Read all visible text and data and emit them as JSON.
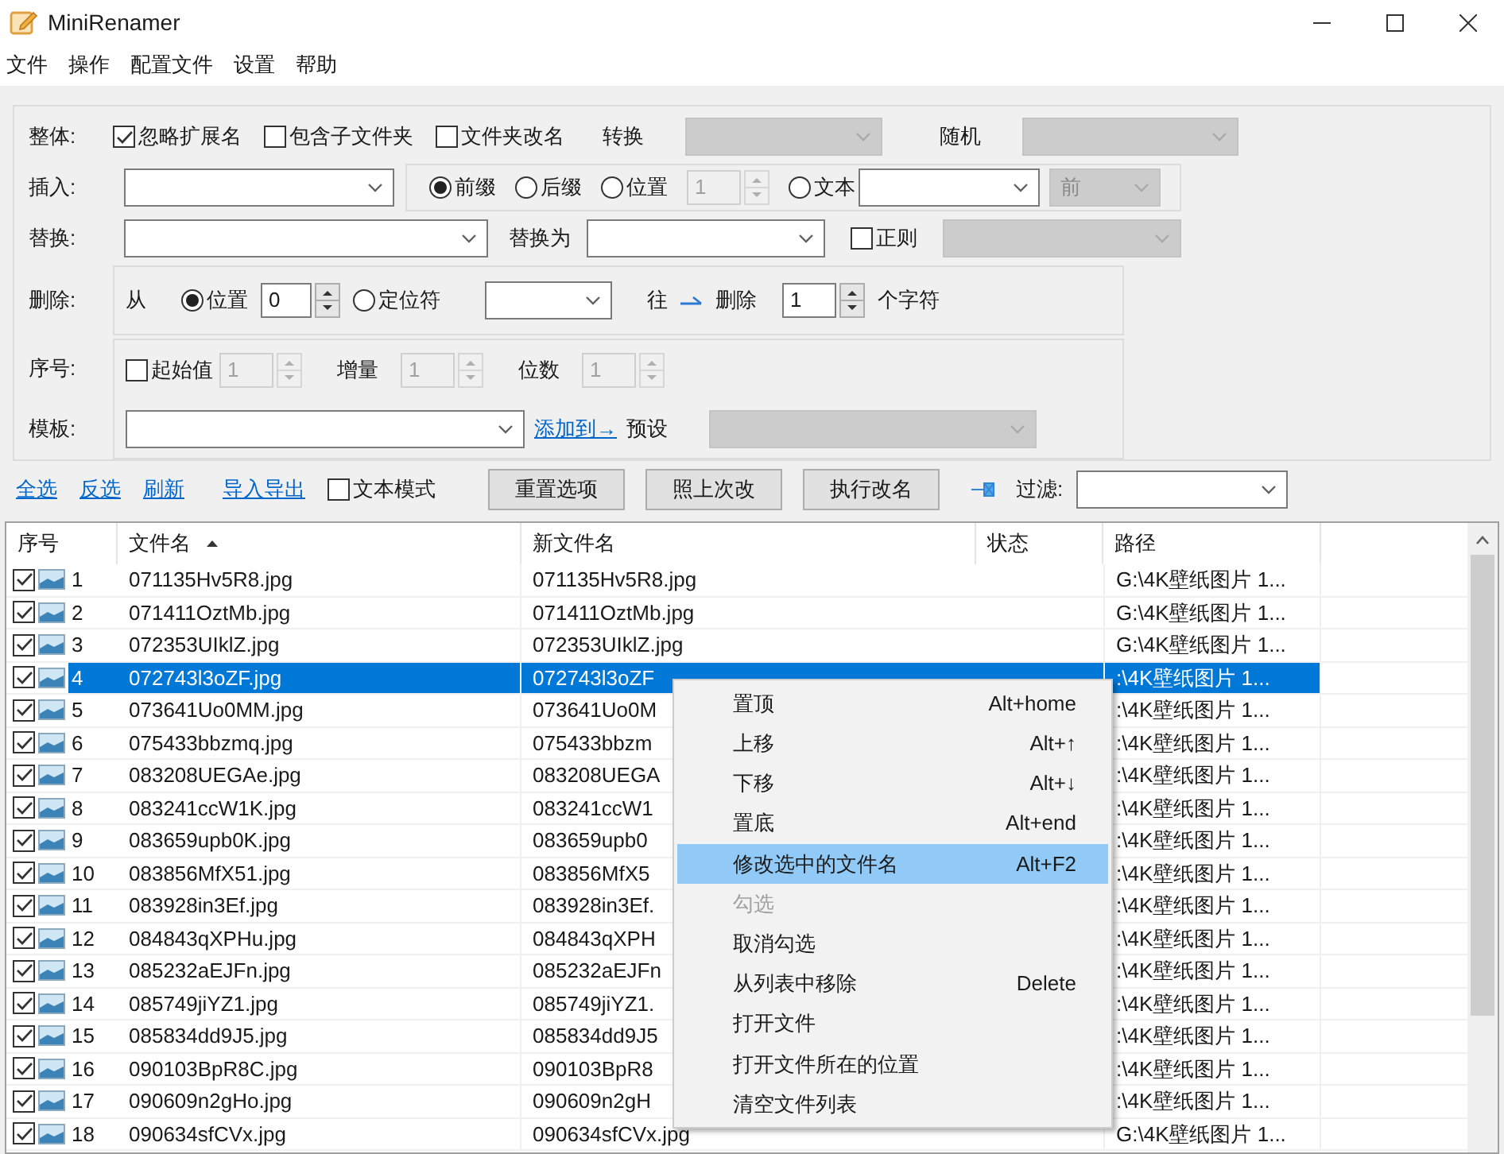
{
  "window": {
    "title": "MiniRenamer"
  },
  "menu_bar": [
    "文件",
    "操作",
    "配置文件",
    "设置",
    "帮助"
  ],
  "options": {
    "whole": {
      "label": "整体:",
      "checkboxes": [
        {
          "label": "忽略扩展名",
          "checked": true
        },
        {
          "label": "包含子文件夹",
          "checked": false
        },
        {
          "label": "文件夹改名",
          "checked": false
        }
      ],
      "convert_label": "转换",
      "convert_field": {
        "disabled": true
      },
      "random_label": "随机",
      "random_field": {
        "disabled": true
      }
    },
    "insert": {
      "label": "插入:",
      "radios": [
        {
          "label": "前缀",
          "selected": true
        },
        {
          "label": "后缀",
          "selected": false
        },
        {
          "label": "位置",
          "selected": false
        },
        {
          "label": "文本",
          "selected": false
        }
      ],
      "position": {
        "value": "1",
        "disabled": true
      },
      "side": {
        "value": "前",
        "disabled": true
      }
    },
    "replace": {
      "label": "替换:",
      "with_label": "替换为",
      "regex": {
        "label": "正则",
        "checked": false
      },
      "regex_field": {
        "disabled": true
      }
    },
    "delete": {
      "label": "删除:",
      "from_label": "从",
      "radios": [
        {
          "label": "位置",
          "selected": true
        },
        {
          "label": "定位符",
          "selected": false
        }
      ],
      "position": {
        "value": "0",
        "disabled": false
      },
      "direction_label": "往",
      "delete_label": "删除",
      "count": {
        "value": "1",
        "disabled": false
      },
      "unit_label": "个字符"
    },
    "sequence": {
      "label": "序号:",
      "start": {
        "label": "起始值",
        "checked": false
      },
      "start_value": {
        "value": "1",
        "disabled": true
      },
      "step_label": "增量",
      "step_value": {
        "value": "1",
        "disabled": true
      },
      "digits_label": "位数",
      "digits_value": {
        "value": "1",
        "disabled": true
      }
    },
    "template": {
      "label": "模板:",
      "add_link": "添加到→",
      "preset_label": "预设",
      "preset_field": {
        "disabled": true
      }
    }
  },
  "toolbar": {
    "links": [
      "全选",
      "反选",
      "刷新",
      "导入导出"
    ],
    "text_mode": {
      "label": "文本模式",
      "checked": false
    },
    "buttons": [
      "重置选项",
      "照上次改",
      "执行改名"
    ],
    "filter_label": "过滤:"
  },
  "table": {
    "columns": [
      {
        "label": "序号",
        "sorted": false
      },
      {
        "label": "文件名",
        "sorted": true
      },
      {
        "label": "新文件名",
        "sorted": false
      },
      {
        "label": "状态",
        "sorted": false
      },
      {
        "label": "路径",
        "sorted": false
      }
    ],
    "rows": [
      {
        "num": "1",
        "name": "071135Hv5R8.jpg",
        "new_name": "071135Hv5R8.jpg",
        "path": "G:\\4K壁纸图片 1...",
        "checked": true,
        "selected": false
      },
      {
        "num": "2",
        "name": "071411OztMb.jpg",
        "new_name": "071411OztMb.jpg",
        "path": "G:\\4K壁纸图片 1...",
        "checked": true,
        "selected": false
      },
      {
        "num": "3",
        "name": "072353UIklZ.jpg",
        "new_name": "072353UIklZ.jpg",
        "path": "G:\\4K壁纸图片 1...",
        "checked": true,
        "selected": false
      },
      {
        "num": "4",
        "name": "072743l3oZF.jpg",
        "new_name": "072743l3oZF",
        "path": ":\\4K壁纸图片 1...",
        "checked": true,
        "selected": true
      },
      {
        "num": "5",
        "name": "073641Uo0MM.jpg",
        "new_name": "073641Uo0M",
        "path": ":\\4K壁纸图片 1...",
        "checked": true,
        "selected": false
      },
      {
        "num": "6",
        "name": "075433bbzmq.jpg",
        "new_name": "075433bbzm",
        "path": ":\\4K壁纸图片 1...",
        "checked": true,
        "selected": false
      },
      {
        "num": "7",
        "name": "083208UEGAe.jpg",
        "new_name": "083208UEGA",
        "path": ":\\4K壁纸图片 1...",
        "checked": true,
        "selected": false
      },
      {
        "num": "8",
        "name": "083241ccW1K.jpg",
        "new_name": "083241ccW1",
        "path": ":\\4K壁纸图片 1...",
        "checked": true,
        "selected": false
      },
      {
        "num": "9",
        "name": "083659upb0K.jpg",
        "new_name": "083659upb0",
        "path": ":\\4K壁纸图片 1...",
        "checked": true,
        "selected": false
      },
      {
        "num": "10",
        "name": "083856MfX51.jpg",
        "new_name": "083856MfX5",
        "path": ":\\4K壁纸图片 1...",
        "checked": true,
        "selected": false
      },
      {
        "num": "11",
        "name": "083928in3Ef.jpg",
        "new_name": "083928in3Ef.",
        "path": ":\\4K壁纸图片 1...",
        "checked": true,
        "selected": false
      },
      {
        "num": "12",
        "name": "084843qXPHu.jpg",
        "new_name": "084843qXPH",
        "path": ":\\4K壁纸图片 1...",
        "checked": true,
        "selected": false
      },
      {
        "num": "13",
        "name": "085232aEJFn.jpg",
        "new_name": "085232aEJFn",
        "path": ":\\4K壁纸图片 1...",
        "checked": true,
        "selected": false
      },
      {
        "num": "14",
        "name": "085749jiYZ1.jpg",
        "new_name": "085749jiYZ1.",
        "path": ":\\4K壁纸图片 1...",
        "checked": true,
        "selected": false
      },
      {
        "num": "15",
        "name": "085834dd9J5.jpg",
        "new_name": "085834dd9J5",
        "path": ":\\4K壁纸图片 1...",
        "checked": true,
        "selected": false
      },
      {
        "num": "16",
        "name": "090103BpR8C.jpg",
        "new_name": "090103BpR8",
        "path": ":\\4K壁纸图片 1...",
        "checked": true,
        "selected": false
      },
      {
        "num": "17",
        "name": "090609n2gHo.jpg",
        "new_name": "090609n2gH",
        "path": ":\\4K壁纸图片 1...",
        "checked": true,
        "selected": false
      },
      {
        "num": "18",
        "name": "090634sfCVx.jpg",
        "new_name": "090634sfCVx.jpg",
        "path": "G:\\4K壁纸图片 1...",
        "checked": true,
        "selected": false
      }
    ]
  },
  "context_menu": [
    {
      "label": "置顶",
      "shortcut": "Alt+home",
      "disabled": false,
      "selected": false
    },
    {
      "label": "上移",
      "shortcut": "Alt+↑",
      "disabled": false,
      "selected": false
    },
    {
      "label": "下移",
      "shortcut": "Alt+↓",
      "disabled": false,
      "selected": false
    },
    {
      "label": "置底",
      "shortcut": "Alt+end",
      "disabled": false,
      "selected": false
    },
    {
      "label": "修改选中的文件名",
      "shortcut": "Alt+F2",
      "disabled": false,
      "selected": true
    },
    {
      "label": "勾选",
      "disabled": true,
      "selected": false
    },
    {
      "label": "取消勾选",
      "disabled": false,
      "selected": false
    },
    {
      "label": "从列表中移除",
      "shortcut": "Delete",
      "disabled": false,
      "selected": false
    },
    {
      "label": "打开文件",
      "disabled": false,
      "selected": false
    },
    {
      "label": "打开文件所在的位置",
      "disabled": false,
      "selected": false
    },
    {
      "label": "清空文件列表",
      "disabled": false,
      "selected": false
    }
  ]
}
